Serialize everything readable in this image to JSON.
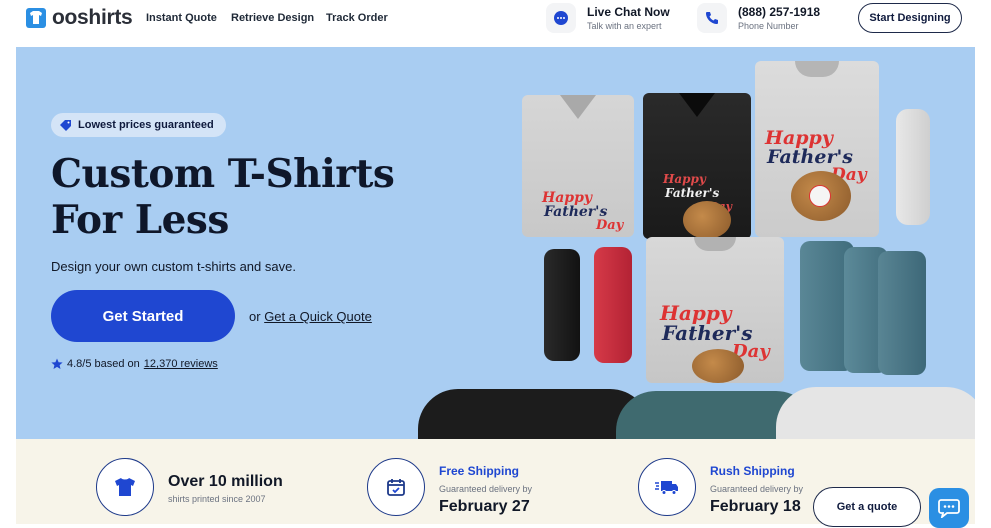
{
  "header": {
    "logo_text": "ooshirts",
    "nav": [
      "Instant Quote",
      "Retrieve Design",
      "Track Order"
    ],
    "chat_title": "Live Chat Now",
    "chat_sub": "Talk with an expert",
    "phone_title": "(888) 257-1918",
    "phone_sub": "Phone Number",
    "start_button": "Start Designing"
  },
  "hero": {
    "badge": "Lowest prices guaranteed",
    "title_line1": "Custom T-Shirts",
    "title_line2": "For Less",
    "subtitle": "Design your own custom t-shirts and save.",
    "cta": "Get Started",
    "or_text": "or",
    "quick_quote": "Get a Quick Quote",
    "rating_text": "4.8/5 based on",
    "reviews_link": "12,370 reviews",
    "shirt_text_1": "Happy",
    "shirt_text_2": "Father's",
    "shirt_text_3": "Day"
  },
  "features": {
    "f1_big": "Over 10 million",
    "f1_small": "shirts printed since 2007",
    "f2_head": "Free Shipping",
    "f2_small": "Guaranteed delivery by",
    "f2_big": "February 27",
    "f3_head": "Rush Shipping",
    "f3_small": "Guaranteed delivery by",
    "f3_big": "February 18"
  },
  "quote_button": "Get a quote",
  "colors": {
    "hero_bg": "#a9cdf2",
    "accent_blue": "#1f47d1",
    "features_bg": "#f7f4e9",
    "chat_bubble": "#2b8fe3"
  }
}
